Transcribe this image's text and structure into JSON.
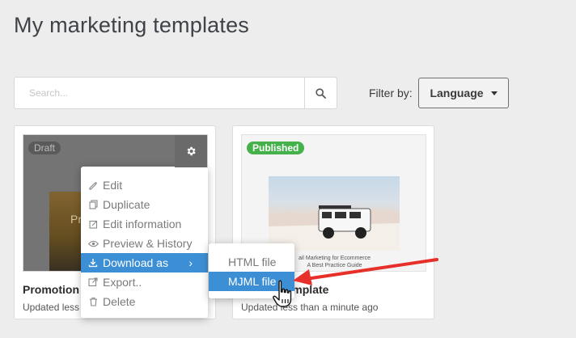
{
  "page": {
    "title": "My marketing templates"
  },
  "search": {
    "placeholder": "Search..."
  },
  "filter": {
    "label": "Filter by:",
    "language_button": "Language"
  },
  "cards": [
    {
      "status": "Draft",
      "title": "Promotion 2",
      "updated": "Updated less",
      "hero_text": "Pr"
    },
    {
      "status": "Published",
      "title": "Template",
      "updated": "Updated less than a minute ago",
      "thumb_line_1": "ail Marketing for Ecommerce",
      "thumb_line_2": "A Best Practice Guide"
    }
  ],
  "context_menu": {
    "items": [
      {
        "label": "Edit",
        "icon": "pencil-icon"
      },
      {
        "label": "Duplicate",
        "icon": "copy-icon"
      },
      {
        "label": "Edit information",
        "icon": "edit-info-icon"
      },
      {
        "label": "Preview & History",
        "icon": "eye-icon"
      },
      {
        "label": "Download as",
        "icon": "download-icon",
        "has_submenu": true
      },
      {
        "label": "Export..",
        "icon": "export-icon"
      },
      {
        "label": "Delete",
        "icon": "trash-icon"
      }
    ],
    "submenu_arrow": "›"
  },
  "download_submenu": {
    "items": [
      {
        "label": "HTML file"
      },
      {
        "label": "MJML file"
      }
    ]
  },
  "colors": {
    "accent_blue": "#3d8fd5",
    "published_green": "#44b14b",
    "annotation_red": "#e8302a",
    "background": "#ededed"
  }
}
